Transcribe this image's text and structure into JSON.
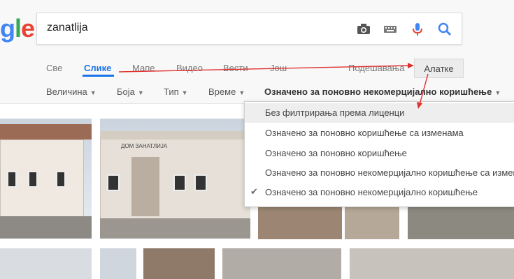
{
  "logo": {
    "partial_text": "gle"
  },
  "search": {
    "query": "zanatlija",
    "icons": [
      "camera-icon",
      "keyboard-icon",
      "mic-icon",
      "search-icon"
    ]
  },
  "tabs": [
    {
      "label": "Све"
    },
    {
      "label": "Слике",
      "active": true
    },
    {
      "label": "Мапе"
    },
    {
      "label": "Видео"
    },
    {
      "label": "Вести"
    },
    {
      "label": "Још"
    },
    {
      "label": "Подешавања"
    }
  ],
  "tools_button": "Алатке",
  "filters": [
    {
      "label": "Величина"
    },
    {
      "label": "Боја"
    },
    {
      "label": "Тип"
    },
    {
      "label": "Време"
    },
    {
      "label": "Означено за поновно некомерцијално коришћење"
    }
  ],
  "usage_rights_menu": {
    "items": [
      {
        "label": "Без филтрирања према лиценци",
        "highlighted": true,
        "selected": false
      },
      {
        "label": "Означено за поновно коришћење са изменама",
        "highlighted": false,
        "selected": false
      },
      {
        "label": "Означено за поновно коришћење",
        "highlighted": false,
        "selected": false
      },
      {
        "label": "Означено за поновно некомерцијално коришћење са изменама",
        "highlighted": false,
        "selected": false
      },
      {
        "label": "Означено за поновно некомерцијално коришћење",
        "highlighted": false,
        "selected": true
      }
    ]
  },
  "thumbnail_sign_text": "ДОМ ЗАНАТЛИЈА",
  "colors": {
    "accent": "#1a73e8",
    "annotation_arrow": "#e03030"
  }
}
